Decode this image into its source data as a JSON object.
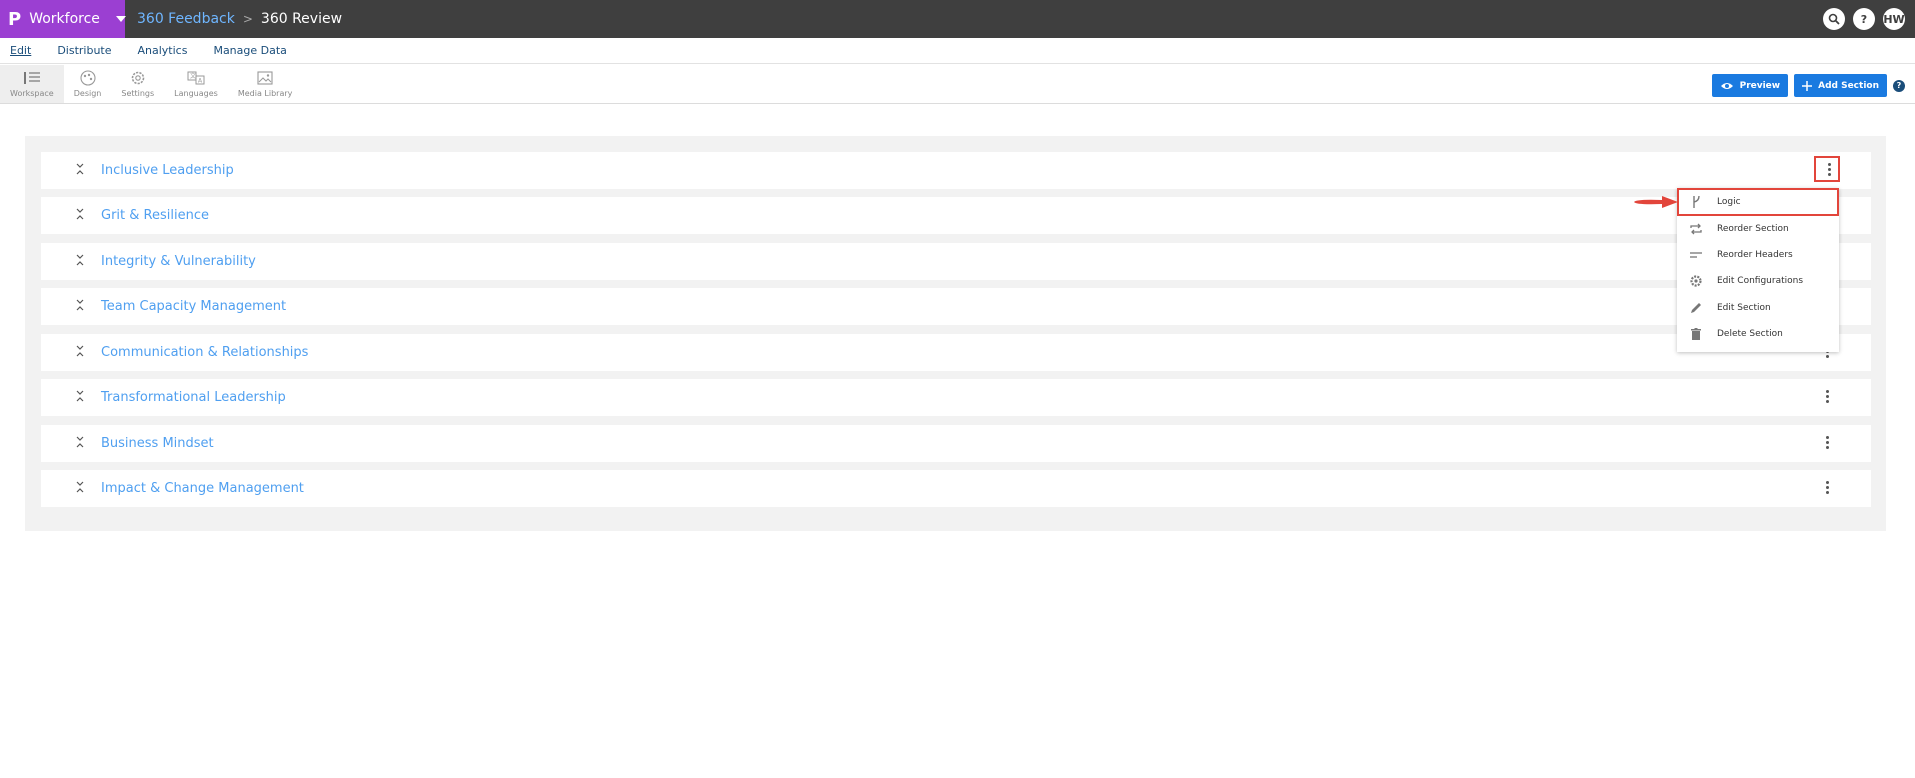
{
  "topbar": {
    "brand_logo": "P",
    "brand_name": "Workforce",
    "breadcrumb_parent": "360 Feedback",
    "breadcrumb_sep": ">",
    "breadcrumb_current": "360 Review",
    "user_initials": "HW"
  },
  "menubar": {
    "items": [
      "Edit",
      "Distribute",
      "Analytics",
      "Manage Data"
    ]
  },
  "toolbar": {
    "tools": [
      "Workspace",
      "Design",
      "Settings",
      "Languages",
      "Media Library"
    ],
    "preview_label": "Preview",
    "add_section_label": "Add Section",
    "help_label": "?"
  },
  "sections": [
    "Inclusive Leadership",
    "Grit & Resilience",
    "Integrity & Vulnerability",
    "Team Capacity Management",
    "Communication & Relationships",
    "Transformational Leadership",
    "Business Mindset",
    "Impact & Change Management"
  ],
  "dropdown": {
    "items": [
      "Logic",
      "Reorder Section",
      "Reorder Headers",
      "Edit Configurations",
      "Edit Section",
      "Delete Section"
    ]
  },
  "colors": {
    "brand": "#9b3fd2",
    "topbar": "#3f3f3f",
    "accent_blue": "#1a7ae0",
    "section_title": "#4f9ff0",
    "highlight": "#e2453b"
  }
}
